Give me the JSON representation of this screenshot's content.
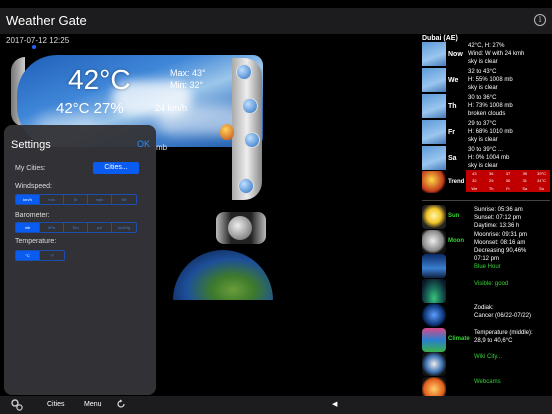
{
  "app": {
    "title": "Weather Gate",
    "info_icon": "info-icon"
  },
  "datetime": "2017-07-12 12:25",
  "current": {
    "temp": "42°C",
    "max": "Max: 43°",
    "min": "Min: 32°",
    "feels_humidity": "42°C 27%",
    "wind": "24 km/h",
    "pressure_unit_fragment": "mb"
  },
  "settings": {
    "title": "Settings",
    "ok_label": "OK",
    "my_cities_label": "My Cities:",
    "cities_button": "Cities...",
    "windspeed_label": "Windspeed:",
    "windspeed_options": [
      "km/h",
      "m/s",
      "kt",
      "mph",
      "Bft"
    ],
    "windspeed_selected": 0,
    "barometer_label": "Barometer:",
    "barometer_options": [
      "mb",
      "hPa",
      "Torr",
      "psi",
      "inchHg"
    ],
    "barometer_selected": 0,
    "temperature_label": "Temperature:",
    "temperature_options": [
      "°C",
      "°F"
    ],
    "temperature_selected": 0
  },
  "forecast": {
    "city": "Dubai (AE)",
    "days": [
      {
        "day": "Now",
        "lines": [
          "42°C, H: 27%",
          "Wind: W with 24 kmh",
          "sky is clear"
        ]
      },
      {
        "day": "We",
        "lines": [
          "32 to 43°C",
          "H: 55% 1008 mb",
          "sky is clear"
        ]
      },
      {
        "day": "Th",
        "lines": [
          "30 to 36°C",
          "H: 73% 1008 mb",
          "broken clouds"
        ]
      },
      {
        "day": "Fr",
        "lines": [
          "29 to 37°C",
          "H: 68% 1010 mb",
          "sky is clear"
        ]
      },
      {
        "day": "Sa",
        "lines": [
          "30 to 39°C ...",
          "H: 0% 1004 mb",
          "sky is clear"
        ]
      }
    ],
    "trend": {
      "label": "Trend",
      "row1": [
        "43",
        "36",
        "37",
        "39",
        "39°C"
      ],
      "row2": [
        "32",
        "29",
        "30",
        "31",
        "31°C"
      ],
      "days": [
        "We",
        "Th",
        "Fr",
        "Sa",
        "Su"
      ]
    }
  },
  "info": [
    {
      "tag": "Sun",
      "lines": [
        "Sunrise: 05:36 am",
        "Sunset: 07:12 pm",
        "Daytime: 13:36 h"
      ]
    },
    {
      "tag": "Moon",
      "lines": [
        "Moonrise: 09:31 pm",
        "Moonset: 08:16 am",
        "Decreasing 90,46%"
      ]
    },
    {
      "tag": "",
      "lines": [
        "07:12 pm",
        "Blue Hour"
      ]
    },
    {
      "tag": "",
      "lines": [
        "Visible: good"
      ]
    },
    {
      "tag": "",
      "lines": [
        "Zodiak:",
        "Cancer (06/22-07/22)"
      ]
    },
    {
      "tag": "Climate",
      "lines": [
        "Temperature (middle):",
        "28,9 to 40,6°C"
      ]
    },
    {
      "tag": "",
      "lines": [
        "Wiki City..."
      ]
    },
    {
      "tag": "",
      "lines": [
        "Webcams"
      ]
    }
  ],
  "bottom": {
    "cities": "Cities",
    "menu": "Menu",
    "back": "◀"
  }
}
